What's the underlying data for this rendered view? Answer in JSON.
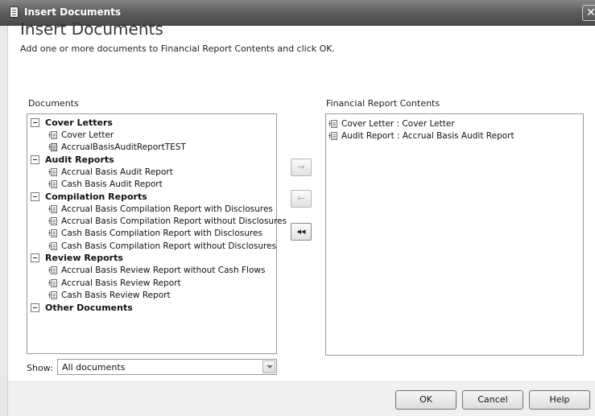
{
  "window": {
    "title": "Insert Documents",
    "close_glyph": "✕"
  },
  "header": {
    "heading": "Insert Documents",
    "subtitle": "Add one or more documents to Financial Report Contents and click OK."
  },
  "documents": {
    "label": "Documents",
    "groups": [
      {
        "name": "Cover Letters",
        "items": [
          {
            "label": "Cover Letter",
            "icon": "document-icon"
          },
          {
            "label": "AccrualBasisAuditReportTEST",
            "icon": "document-alt-icon"
          }
        ]
      },
      {
        "name": "Audit Reports",
        "items": [
          {
            "label": "Accrual Basis Audit Report",
            "icon": "document-icon"
          },
          {
            "label": "Cash Basis Audit Report",
            "icon": "document-icon"
          }
        ]
      },
      {
        "name": "Compilation Reports",
        "items": [
          {
            "label": "Accrual Basis Compilation Report with Disclosures",
            "icon": "document-icon"
          },
          {
            "label": "Accrual Basis Compilation Report without Disclosures",
            "icon": "document-icon"
          },
          {
            "label": "Cash Basis Compilation Report with Disclosures",
            "icon": "document-icon"
          },
          {
            "label": "Cash Basis Compilation Report without Disclosures",
            "icon": "document-icon"
          }
        ]
      },
      {
        "name": "Review Reports",
        "items": [
          {
            "label": "Accrual Basis Review Report without Cash Flows",
            "icon": "document-icon"
          },
          {
            "label": "Accrual Basis Review Report",
            "icon": "document-icon"
          },
          {
            "label": "Cash Basis Review Report",
            "icon": "document-icon"
          }
        ]
      },
      {
        "name": "Other Documents",
        "items": []
      }
    ]
  },
  "contents": {
    "label": "Financial Report Contents",
    "items": [
      {
        "label": "Cover Letter : Cover Letter",
        "icon": "document-icon"
      },
      {
        "label": "Audit Report : Accrual Basis Audit Report",
        "icon": "document-icon"
      }
    ]
  },
  "move_buttons": {
    "add": {
      "glyph": "→",
      "enabled": false
    },
    "remove": {
      "glyph": "←",
      "enabled": false
    },
    "remove_all": {
      "glyph": "◂◂",
      "enabled": true
    }
  },
  "filter": {
    "label": "Show:",
    "value": "All documents"
  },
  "footer": {
    "ok": "OK",
    "cancel": "Cancel",
    "help": "Help"
  },
  "colors": {
    "titlebar": "#5c5c5c",
    "footer": "#f0f0f0",
    "panel_border": "#9a9a9a"
  }
}
